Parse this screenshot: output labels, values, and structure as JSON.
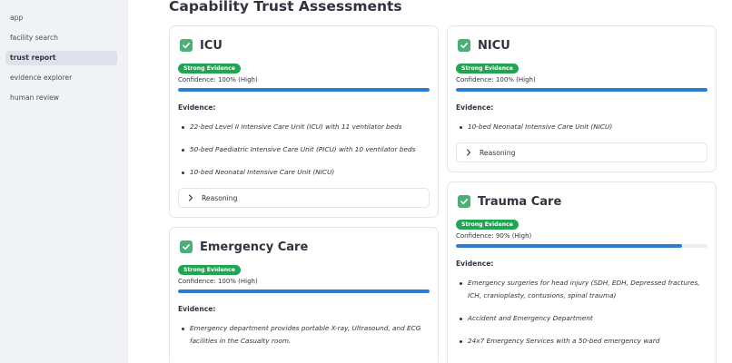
{
  "sidebar": {
    "items": [
      {
        "label": "app",
        "active": false
      },
      {
        "label": "facility search",
        "active": false
      },
      {
        "label": "trust report",
        "active": true
      },
      {
        "label": "evidence explorer",
        "active": false
      },
      {
        "label": "human review",
        "active": false
      }
    ]
  },
  "main": {
    "title": "Capability Trust Assessments",
    "evidence_label": "Evidence:",
    "reasoning_label": "Reasoning",
    "cards": {
      "icu": {
        "title": "ICU",
        "badge": "Strong Evidence",
        "confidence": "Confidence: 100% (High)",
        "progress": 1.0,
        "evidence": [
          "22-bed Level II Intensive Care Unit (ICU) with 11 ventilator beds",
          "50-bed Paediatric Intensive Care Unit (PICU) with 10 ventilator beds",
          "10-bed Neonatal Intensive Care Unit (NICU)"
        ]
      },
      "emergency": {
        "title": "Emergency Care",
        "badge": "Strong Evidence",
        "confidence": "Confidence: 100% (High)",
        "progress": 1.0,
        "evidence": [
          "Emergency department provides portable X-ray, Ultrasound, and ECG facilities in the Casualty room."
        ]
      },
      "nicu": {
        "title": "NICU",
        "badge": "Strong Evidence",
        "confidence": "Confidence: 100% (High)",
        "progress": 1.0,
        "evidence": [
          "10-bed Neonatal Intensive Care Unit (NICU)"
        ]
      },
      "trauma": {
        "title": "Trauma Care",
        "badge": "Strong Evidence",
        "confidence": "Confidence: 90% (High)",
        "progress": 0.9,
        "evidence": [
          "Emergency surgeries for head injury (SDH, EDH, Depressed fractures, ICH, cranioplasty, contusions, spinal trauma)",
          "Accident and Emergency Department",
          "24x7 Emergency Services with a 50-bed emergency ward"
        ]
      }
    }
  },
  "colors": {
    "sidebar_bg": "#f0f2f6",
    "badge_green": "#21a553",
    "check_green": "#4caf7a",
    "progress_blue": "#2a7dd1"
  },
  "icons": {
    "check": "check-box-icon",
    "chevron": "chevron-right-icon"
  }
}
